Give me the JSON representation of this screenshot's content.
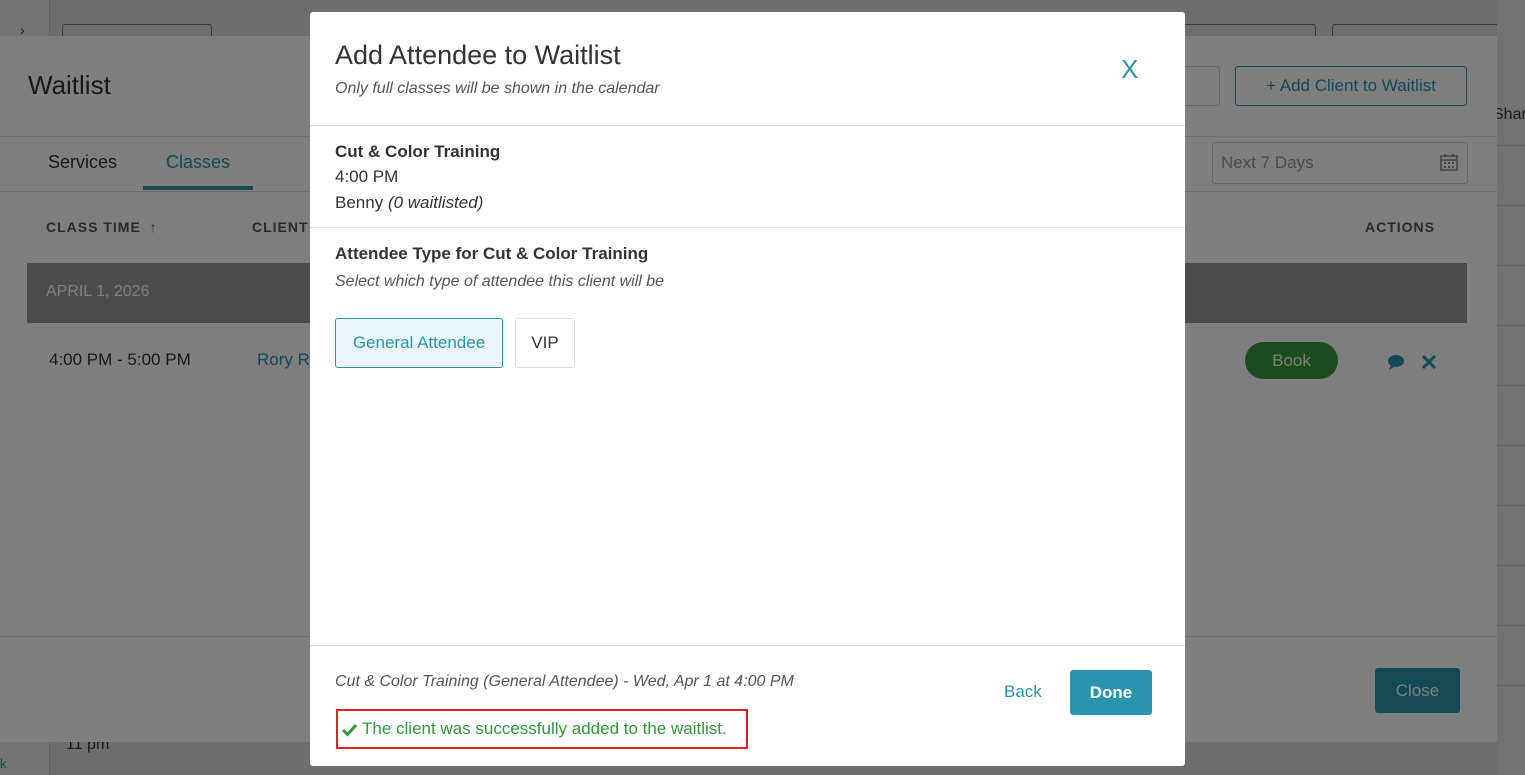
{
  "background": {
    "panel_title": "Waitlist",
    "add_client_label": "+ Add Client to Waitlist",
    "tabs": [
      {
        "label": "Services"
      },
      {
        "label": "Classes"
      }
    ],
    "date_filter_value": "Next 7 Days",
    "columns": {
      "class_time": "CLASS TIME",
      "client": "CLIENT",
      "actions": "ACTIONS"
    },
    "date_band": "APRIL 1, 2026",
    "row": {
      "time": "4:00 PM - 5:00 PM",
      "client": "Rory R",
      "book_label": "Book"
    },
    "close_label": "Close",
    "cal_hour_label": "11 pm",
    "cal_side_text": "Shar",
    "cal_corner_text": "k"
  },
  "modal": {
    "title": "Add Attendee to Waitlist",
    "subtitle": "Only full classes will be shown in the calendar",
    "close_label": "X",
    "class": {
      "name": "Cut & Color Training",
      "time": "4:00 PM",
      "staff": "Benny",
      "waitlisted": "(0 waitlisted)"
    },
    "attendee_type": {
      "heading": "Attendee Type for Cut & Color Training",
      "subheading": "Select which type of attendee this client will be",
      "options": [
        {
          "label": "General Attendee",
          "selected": true
        },
        {
          "label": "VIP",
          "selected": false
        }
      ]
    },
    "footer": {
      "summary": "Cut & Color Training (General Attendee) - Wed, Apr 1 at 4:00 PM",
      "back_label": "Back",
      "done_label": "Done",
      "success_message": "The client was successfully added to the waitlist."
    }
  },
  "colors": {
    "accent": "#2a93ad",
    "success": "#2e9a3a",
    "book_green": "#3b9a3e",
    "highlight_border": "#e02020"
  }
}
